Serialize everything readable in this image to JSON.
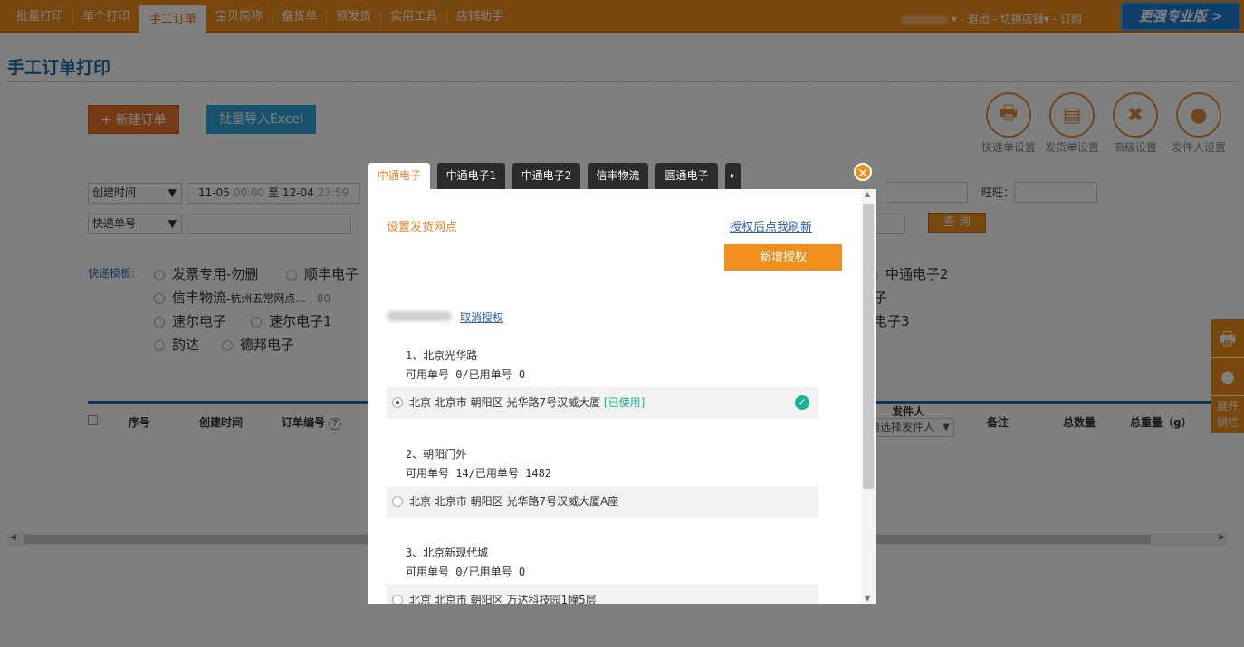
{
  "nav": [
    "批量打印",
    "单个打印",
    "手工订单",
    "宝贝简称",
    "备货单",
    "预发货",
    "实用工具",
    "店铺助手"
  ],
  "nav_active": 2,
  "topright": {
    "user_blurred": "",
    "logout": "退出",
    "switch_store": "切换店铺",
    "order": "订购"
  },
  "promo": "更强专业版 >",
  "page_title": "手工订单打印",
  "buttons": {
    "new_order": "+ 新建订单",
    "import_excel": "批量导入Excel",
    "query": "查 询"
  },
  "settings": [
    {
      "label": "快递单设置",
      "icon": "printer-icon"
    },
    {
      "label": "发货单设置",
      "icon": "invoice-icon"
    },
    {
      "label": "高级设置",
      "icon": "tools-icon"
    },
    {
      "label": "发件人设置",
      "icon": "person-icon"
    }
  ],
  "filters": {
    "time_select": "创建时间",
    "time_range_start": "11-05",
    "time_range_start_sub": "00:00",
    "time_range_sep": "至",
    "time_range_end": "12-04",
    "time_range_end_sub": "23:59",
    "express_select": "快递单号",
    "wangwang_label": "旺旺："
  },
  "templates": {
    "label": "快递模板:",
    "items": [
      "发票专用-勿删",
      "顺丰电子",
      "中通电子2",
      "信丰物流",
      "-杭州五常网点...",
      "80",
      "子",
      "速尔电子",
      "速尔电子1",
      "电子3",
      "韵达",
      "德邦电子"
    ]
  },
  "table_headers": [
    "序号",
    "创建时间",
    "订单编号",
    "发件人",
    "请选择发件人",
    "备注",
    "总数量",
    "总重量（g）"
  ],
  "side": {
    "expand": "展开",
    "sidebar": "侧栏"
  },
  "modal": {
    "tabs": [
      "中通电子",
      "中通电子1",
      "中通电子2",
      "信丰物流",
      "圆通电子"
    ],
    "active_tab": 0,
    "title": "设置发货网点",
    "refresh_link": "授权后点我刷新",
    "new_auth": "新增授权",
    "cancel_auth": "取消授权",
    "sites": [
      {
        "name": "1、北京光华路",
        "stock": "可用单号 0/已用单号 0",
        "address": "北京 北京市 朝阳区 光华路7号汉威大厦",
        "tag": "[已使用]",
        "selected": true
      },
      {
        "name": "2、朝阳门外",
        "stock": "可用单号 14/已用单号 1482",
        "address": "北京 北京市 朝阳区 光华路7号汉威大厦A座",
        "tag": "",
        "selected": false
      },
      {
        "name": "3、北京新现代城",
        "stock": "可用单号 0/已用单号 0",
        "address": "北京 北京市 朝阳区 万达科技园1幢5层",
        "tag": "",
        "selected": false
      }
    ]
  },
  "colors": {
    "accent": "#f08f1d",
    "link": "#2a5db0",
    "title": "#1a6ea8",
    "used": "#1ab394"
  }
}
